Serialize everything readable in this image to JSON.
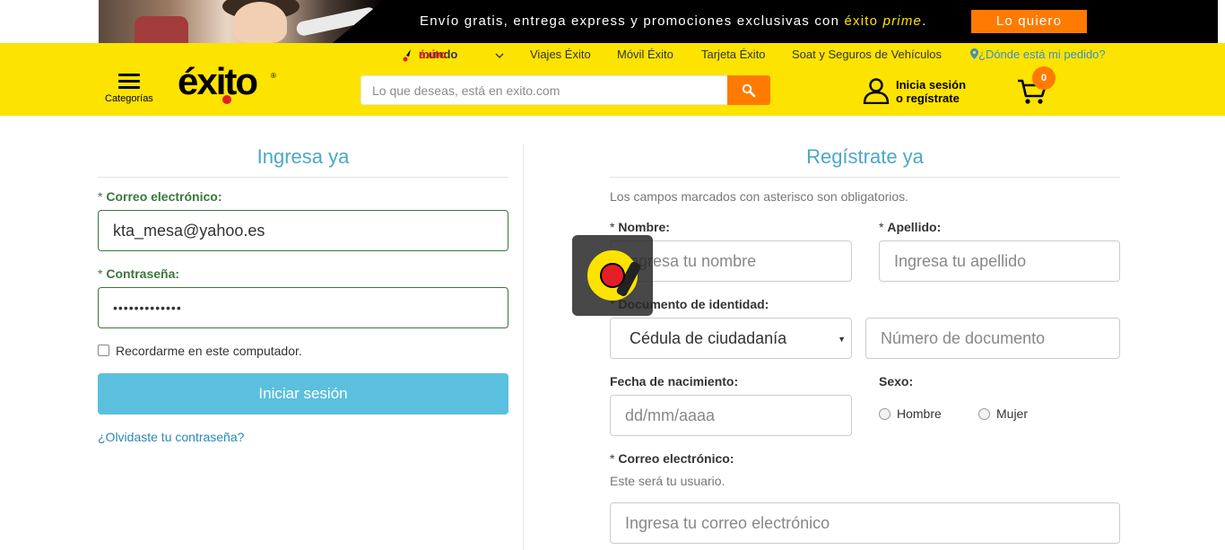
{
  "promo": {
    "text_prefix": "Envío gratis, entrega express y promociones exclusivas con ",
    "brand": "éxito",
    "prime": "prime",
    "suffix": ".",
    "button": "Lo quiero"
  },
  "topnav": {
    "mundo_prefix": "mundo ",
    "mundo_brand": "éxito",
    "items": [
      "Viajes Éxito",
      "Móvil Éxito",
      "Tarjeta Éxito",
      "Soat y Seguros de Vehículos"
    ],
    "location": "¿Dónde está mi pedido?"
  },
  "header": {
    "menu_label": "Categorías",
    "logo": "éxito",
    "logo_reg": "®",
    "search_placeholder": "Lo que deseas, está en exito.com",
    "login_line1": "Inicia sesión",
    "login_line2": "o regístrate",
    "cart_count": "0"
  },
  "login": {
    "title": "Ingresa ya",
    "email_label": "Correo electrónico:",
    "email_value": "kta_mesa@yahoo.es",
    "password_label": "Contraseña:",
    "password_value": "•••••••••••••",
    "remember": "Recordarme en este computador.",
    "submit": "Iniciar sesión",
    "forgot": "¿Olvidaste tu contraseña?"
  },
  "register": {
    "title": "Regístrate ya",
    "note": "Los campos marcados con asterisco son obligatorios.",
    "name_label": "Nombre:",
    "name_placeholder": "Ingresa tu nombre",
    "lastname_label": "Apellido:",
    "lastname_placeholder": "Ingresa tu apellido",
    "doc_label": "Documento de identidad:",
    "doc_type": "Cédula de ciudadanía",
    "doc_number_placeholder": "Número de documento",
    "birth_label": "Fecha de nacimiento:",
    "birth_placeholder": "dd/mm/aaaa",
    "sex_label": "Sexo:",
    "sex_options": [
      "Hombre",
      "Mujer"
    ],
    "email_label": "Correo electrónico:",
    "email_help": "Este será tu usuario.",
    "email_placeholder": "Ingresa tu correo electrónico"
  },
  "required_mark": "* ",
  "colors": {
    "yellow": "#fce300",
    "orange": "#ff7a00",
    "red": "#e41e26",
    "title_blue": "#4aa8c5",
    "button_blue": "#5bc0de",
    "valid_green": "#3c763d"
  }
}
